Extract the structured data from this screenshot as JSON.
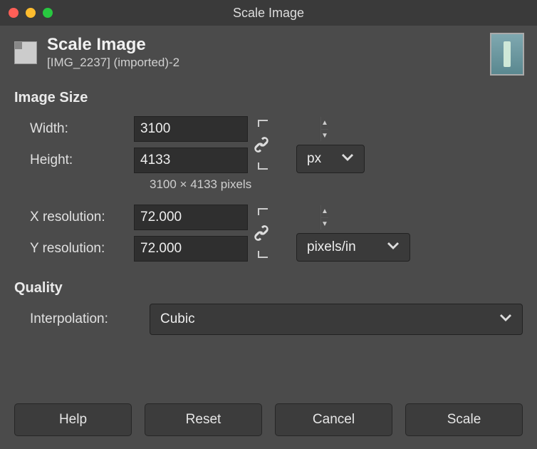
{
  "window": {
    "title": "Scale Image"
  },
  "header": {
    "title": "Scale Image",
    "subtitle": "[IMG_2237] (imported)-2"
  },
  "sections": {
    "image_size": {
      "title": "Image Size",
      "width_label": "Width:",
      "width_value": "3100",
      "height_label": "Height:",
      "height_value": "4133",
      "pixel_summary": "3100 × 4133 pixels",
      "unit_selected": "px",
      "xres_label": "X resolution:",
      "xres_value": "72.000",
      "yres_label": "Y resolution:",
      "yres_value": "72.000",
      "res_unit_selected": "pixels/in"
    },
    "quality": {
      "title": "Quality",
      "interpolation_label": "Interpolation:",
      "interpolation_selected": "Cubic"
    }
  },
  "buttons": {
    "help": "Help",
    "reset": "Reset",
    "cancel": "Cancel",
    "scale": "Scale"
  }
}
